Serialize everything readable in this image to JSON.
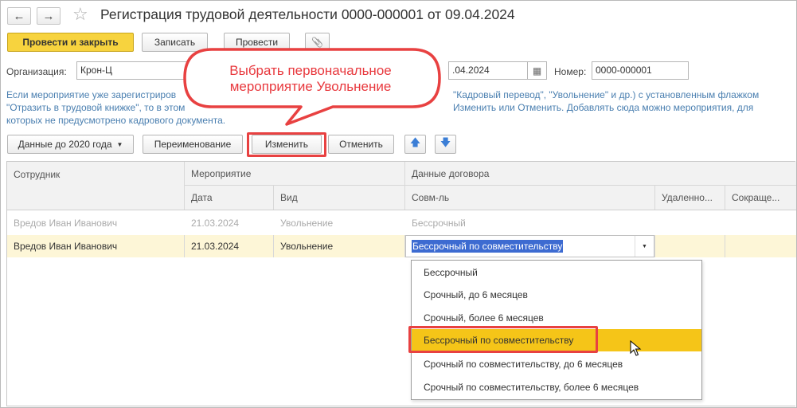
{
  "window": {
    "title": "Регистрация трудовой деятельности 0000-000001 от 09.04.2024",
    "back_icon": "←",
    "forward_icon": "→",
    "star_icon": "☆"
  },
  "toolbar": {
    "post_close_label": "Провести и закрыть",
    "save_label": "Записать",
    "post_label": "Провести",
    "attach_icon": "📎"
  },
  "form": {
    "org_label": "Организация:",
    "org_value": "Крон-Ц",
    "date_value": ".04.2024",
    "number_label": "Номер:",
    "number_value": "0000-000001",
    "calendar_icon": "▦"
  },
  "info_text": {
    "line1_left": "Если мероприятие уже зарегистриров",
    "line1_right": "\"Кадровый перевод\", \"Увольнение\" и др.) с установленным флажком",
    "line2_left": "\"Отразить в трудовой книжке\", то в этом",
    "line2_right": "Изменить или Отменить. Добавлять сюда можно мероприятия, для",
    "line3": "которых не предусмотрено кадрового документа."
  },
  "callout": {
    "text_line1": "Выбрать первоначальное",
    "text_line2": "мероприятие Увольнение"
  },
  "actions": {
    "data_before_2020_label": "Данные до 2020 года",
    "rename_label": "Переименование",
    "change_label": "Изменить",
    "cancel_label": "Отменить",
    "up_icon": "🡅",
    "down_icon": "🡇"
  },
  "table": {
    "headers": {
      "employee": "Сотрудник",
      "event": "Мероприятие",
      "contract": "Данные договора",
      "date": "Дата",
      "type": "Вид",
      "combination": "Совм-ль",
      "remote": "Удаленно...",
      "reduced": "Сокраще..."
    },
    "rows": [
      {
        "employee": "Вредов Иван Иванович",
        "date": "21.03.2024",
        "type": "Увольнение",
        "combination": "Бессрочный"
      },
      {
        "employee": "Вредов Иван Иванович",
        "date": "21.03.2024",
        "type": "Увольнение",
        "combination": "Бессрочный по совместительству"
      }
    ]
  },
  "dropdown": {
    "options": [
      "Бессрочный",
      "Срочный, до 6 месяцев",
      "Срочный, более 6 месяцев",
      "Бессрочный по совместительству",
      "Срочный по совместительству, до 6 месяцев",
      "Срочный по совместительству, более 6 месяцев"
    ],
    "selected_index": 3
  },
  "colors": {
    "accent_yellow": "#f7d33e",
    "highlight_red": "#e84141",
    "selected_row": "#fdf6d7",
    "selected_option": "#f5c518",
    "link_blue": "#4a7fb0",
    "arrow_blue": "#3b7ed6"
  }
}
